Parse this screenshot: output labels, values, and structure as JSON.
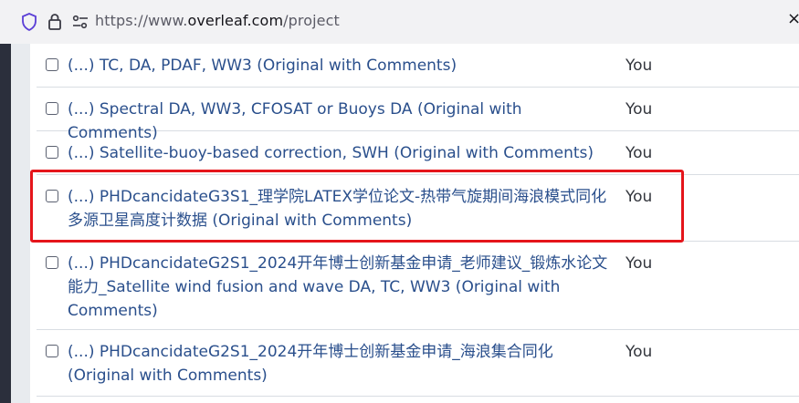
{
  "browser": {
    "url_prefix": "https://www.",
    "url_domain": "overleaf.com",
    "url_path": "/project",
    "icons": [
      "shield-icon",
      "lock-icon",
      "page-permissions-icon"
    ]
  },
  "projects": [
    {
      "title": "(...) TC, DA, PDAF, WW3 (Original with Comments)",
      "owner": "You"
    },
    {
      "title": "(...) Spectral DA, WW3, CFOSAT or Buoys DA (Original with Comments)",
      "owner": "You"
    },
    {
      "title": "(...) Satellite-buoy-based correction, SWH (Original with Comments)",
      "owner": "You"
    },
    {
      "title": "(...) PHDcancidateG3S1_理学院LATEX学位论文-热带气旋期间海浪模式同化多源卫星高度计数据 (Original with Comments)",
      "owner": "You"
    },
    {
      "title": "(...) PHDcancidateG2S1_2024开年博士创新基金申请_老师建议_锻炼水论文能力_Satellite wind fusion and wave DA, TC, WW3 (Original with Comments)",
      "owner": "You"
    },
    {
      "title": "(...) PHDcancidateG2S1_2024开年博士创新基金申请_海浪集合同化 (Original with Comments)",
      "owner": "You"
    }
  ],
  "highlight_color": "#e5151b"
}
